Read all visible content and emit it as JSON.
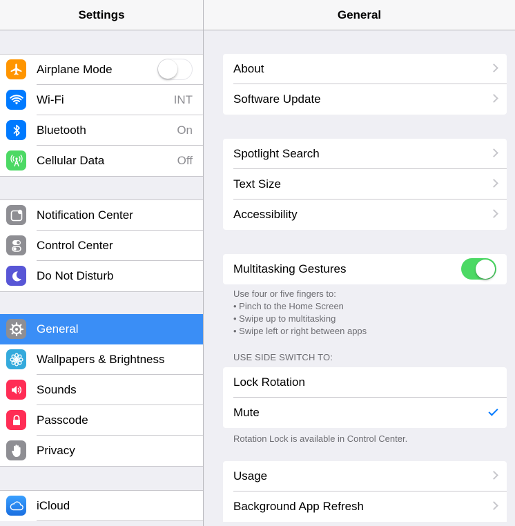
{
  "left_pane": {
    "title": "Settings",
    "groups": [
      {
        "items": [
          {
            "label": "Airplane Mode",
            "icon": "airplane-icon",
            "icon_color": "#ff9500",
            "toggle": "off"
          },
          {
            "label": "Wi-Fi",
            "icon": "wifi-icon",
            "icon_color": "#007aff",
            "value": "INT"
          },
          {
            "label": "Bluetooth",
            "icon": "bluetooth-icon",
            "icon_color": "#007aff",
            "value": "On"
          },
          {
            "label": "Cellular Data",
            "icon": "cellular-icon",
            "icon_color": "#4cd964",
            "value": "Off"
          }
        ]
      },
      {
        "items": [
          {
            "label": "Notification Center",
            "icon": "notification-center-icon",
            "icon_color": "#8e8e93"
          },
          {
            "label": "Control Center",
            "icon": "control-center-icon",
            "icon_color": "#8e8e93"
          },
          {
            "label": "Do Not Disturb",
            "icon": "moon-icon",
            "icon_color": "#5856d6"
          }
        ]
      },
      {
        "items": [
          {
            "label": "General",
            "icon": "gear-icon",
            "icon_color": "#8e8e93",
            "selected": true
          },
          {
            "label": "Wallpapers & Brightness",
            "icon": "flower-icon",
            "icon_color": "#34aadc"
          },
          {
            "label": "Sounds",
            "icon": "speaker-icon",
            "icon_color": "#ff2d55"
          },
          {
            "label": "Passcode",
            "icon": "lock-icon",
            "icon_color": "#ff2d55"
          },
          {
            "label": "Privacy",
            "icon": "hand-icon",
            "icon_color": "#8e8e93"
          }
        ]
      },
      {
        "items": [
          {
            "label": "iCloud",
            "icon": "cloud-icon",
            "icon_color": "#1a8cff"
          }
        ]
      }
    ]
  },
  "right_pane": {
    "title": "General",
    "group1": [
      "About",
      "Software Update"
    ],
    "group2": [
      "Spotlight Search",
      "Text Size",
      "Accessibility"
    ],
    "multitasking": {
      "label": "Multitasking Gestures",
      "toggle": "on"
    },
    "multitasking_footer": [
      "Use four or five fingers to:",
      "• Pinch to the Home Screen",
      "• Swipe up to multitasking",
      "• Swipe left or right between apps"
    ],
    "side_switch_header": "USE SIDE SWITCH TO:",
    "side_switch_options": [
      {
        "label": "Lock Rotation",
        "checked": false
      },
      {
        "label": "Mute",
        "checked": true
      }
    ],
    "side_switch_footer": "Rotation Lock is available in Control Center.",
    "group5": [
      "Usage",
      "Background App Refresh"
    ]
  },
  "colors": {
    "accent": "#007aff",
    "selection": "#3a8ef6",
    "toggle_on": "#4cd964"
  }
}
